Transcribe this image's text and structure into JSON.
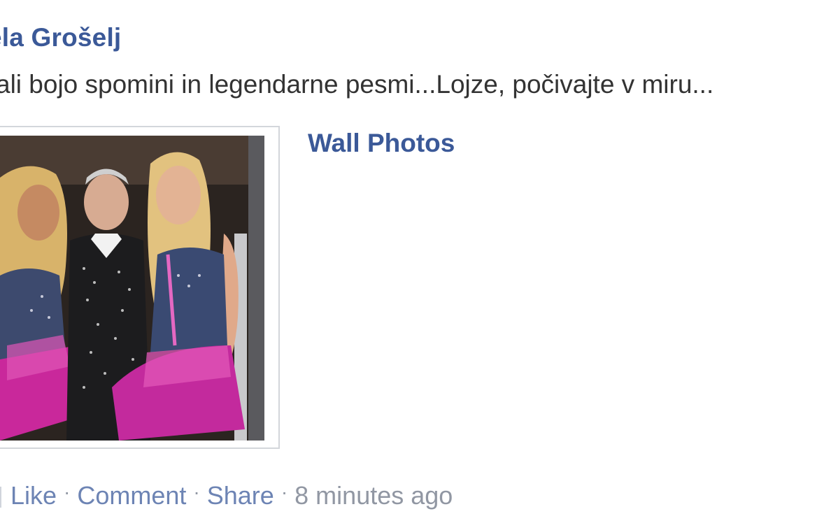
{
  "post": {
    "author": "ela Grošelj",
    "message": "ali bojo spomini in legendarne pesmi...Lojze, počivajte v miru...",
    "album_link": "Wall Photos",
    "photo_icon": "wall-photo-image"
  },
  "actions": {
    "like": "Like",
    "comment": "Comment",
    "share": "Share",
    "separator": "·",
    "timestamp": "8 minutes ago"
  },
  "colors": {
    "link": "#3b5998",
    "action_link": "#6d84b4",
    "meta": "#9197a3",
    "text": "#333333"
  }
}
